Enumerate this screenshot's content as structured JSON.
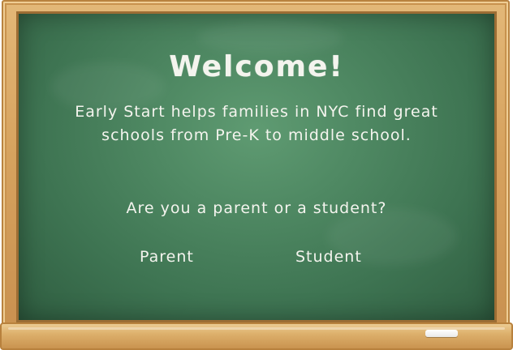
{
  "board": {
    "title": "Welcome!",
    "intro": "Early Start helps families in NYC find great schools from Pre-K to middle school.",
    "question": "Are you a parent or a student?",
    "choices": {
      "parent": "Parent",
      "student": "Student"
    }
  },
  "colors": {
    "chalkboard": "#3e7452",
    "frame": "#d7a35f",
    "chalk": "#f4f4ee"
  }
}
